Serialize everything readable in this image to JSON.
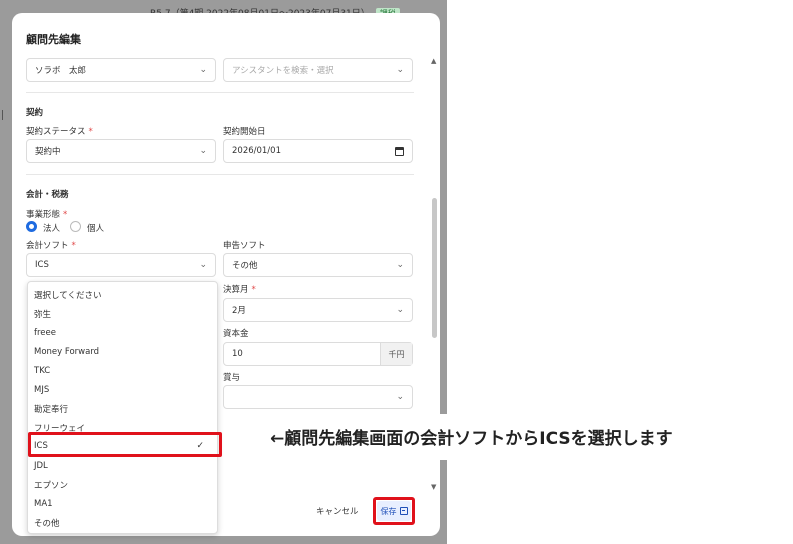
{
  "background": {
    "period_text": "R5.7（第4期 2022年08月01日～2023年07月31日）",
    "badge": "課税"
  },
  "modal": {
    "title": "顧問先編集",
    "advisor_select": "ソラボ　太郎",
    "assistant_placeholder": "アシスタントを検索・選択",
    "contract_section": "契約",
    "contract_status_label": "契約ステータス",
    "contract_status_value": "契約中",
    "contract_start_label": "契約開始日",
    "contract_start_value": "2026/01/01",
    "accounting_section": "会計・税務",
    "business_type_label": "事業形態",
    "business_type_options": [
      "法人",
      "個人"
    ],
    "accounting_software_label": "会計ソフト",
    "accounting_software_value": "ICS",
    "tax_software_label": "申告ソフト",
    "tax_software_value": "その他",
    "fiscal_month_label": "決算月",
    "fiscal_month_value": "2月",
    "capital_label": "資本金",
    "capital_value": "10",
    "capital_unit": "千円",
    "bonus_label": "賞与",
    "required_mark": "*",
    "cancel_label": "キャンセル",
    "save_label": "保存"
  },
  "dropdown": {
    "options": [
      "選択してください",
      "弥生",
      "freee",
      "Money Forward",
      "TKC",
      "MJS",
      "勘定奉行",
      "フリーウェイ",
      "ICS",
      "JDL",
      "エプソン",
      "MA1",
      "その他"
    ],
    "selected": "ICS",
    "check_glyph": "✓"
  },
  "annotation": {
    "text": "←顧問先編集画面の会計ソフトからICSを選択します"
  },
  "colors": {
    "highlight": "#e0111b",
    "accent": "#1e6be0"
  }
}
